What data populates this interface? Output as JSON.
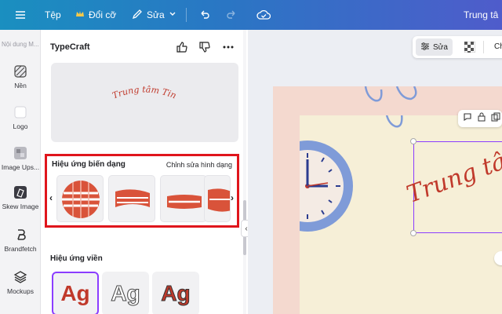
{
  "topbar": {
    "file_label": "Tệp",
    "resize_label": "Đổi cỡ",
    "edit_label": "Sửa",
    "doc_title": "Trung tâ"
  },
  "rail": {
    "top_label": "Nội dung M...",
    "items": [
      {
        "label": "Nền",
        "icon": "hatch-square-icon"
      },
      {
        "label": "Logo",
        "icon": "blank-square-icon"
      },
      {
        "label": "Image Ups...",
        "icon": "image-upscale-icon"
      },
      {
        "label": "Skew Image",
        "icon": "skew-image-icon"
      },
      {
        "label": "Brandfetch",
        "icon": "brandfetch-icon"
      },
      {
        "label": "Mockups",
        "icon": "layers-icon"
      }
    ]
  },
  "panel": {
    "title": "TypeCraft",
    "preview_text": "Trung tâm Tin",
    "warp_section": {
      "title": "Hiệu ứng biến dạng",
      "link": "Chỉnh sửa hình dạng",
      "thumbs": [
        "sphere-warp",
        "flag-warp",
        "arch-warp",
        "bulge-warp"
      ]
    },
    "border_section": {
      "title": "Hiệu ứng viền",
      "samples": [
        "Ag",
        "Ag",
        "Ag"
      ]
    }
  },
  "canvas": {
    "edit_button": "Sửa",
    "partial_label": "Ch",
    "design_text": "Trung tâm",
    "colors": {
      "accent": "#8b3dff",
      "highlight": "#e0151c",
      "text_red": "#c0392b"
    }
  }
}
